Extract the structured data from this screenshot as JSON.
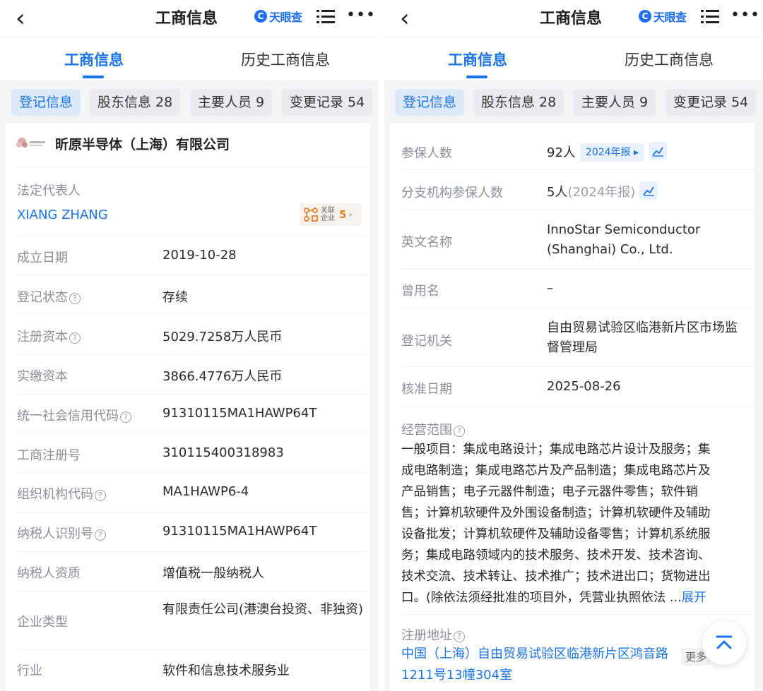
{
  "header": {
    "title": "工商信息",
    "logo_text": "天眼查",
    "logo_mark": "C",
    "back_icon": "chevron-left-icon",
    "menu_icon": "list-icon",
    "more_icon": "more-horizontal-icon",
    "more_glyph": "•••"
  },
  "tabs": [
    {
      "label": "工商信息",
      "active": true
    },
    {
      "label": "历史工商信息",
      "active": false
    }
  ],
  "chips": [
    {
      "label": "登记信息",
      "active": true
    },
    {
      "label": "股东信息 28",
      "active": false
    },
    {
      "label": "主要人员 9",
      "active": false
    },
    {
      "label": "变更记录 54",
      "active": false
    }
  ],
  "left": {
    "company_name": "昕原半导体（上海）有限公司",
    "legal_rep": {
      "label": "法定代表人",
      "value": "XIANG ZHANG",
      "related_label": "关联企业",
      "related_count": "5"
    },
    "rows": [
      {
        "label": "成立日期",
        "value": "2019-10-28",
        "help": false
      },
      {
        "label": "登记状态",
        "value": "存续",
        "help": true
      },
      {
        "label": "注册资本",
        "value": "5029.7258万人民币",
        "help": true
      },
      {
        "label": "实缴资本",
        "value": "3866.4776万人民币",
        "help": false
      },
      {
        "label": "统一社会信用代码",
        "value": "91310115MA1HAWP64T",
        "help": true
      },
      {
        "label": "工商注册号",
        "value": "310115400318983",
        "help": false
      },
      {
        "label": "组织机构代码",
        "value": "MA1HAWP6-4",
        "help": true
      },
      {
        "label": "纳税人识别号",
        "value": "91310115MA1HAWP64T",
        "help": true
      },
      {
        "label": "纳税人资质",
        "value": "增值税一般纳税人",
        "help": false
      },
      {
        "label": "企业类型",
        "value": "有限责任公司(港澳台投资、非独资)",
        "help": false
      },
      {
        "label": "行业",
        "value": "软件和信息技术服务业",
        "help": false
      }
    ]
  },
  "right": {
    "insured": {
      "label": "参保人数",
      "value": "92人",
      "badge": "2024年报 ▸"
    },
    "branch_insured": {
      "label": "分支机构参保人数",
      "value": "5人",
      "note": "(2024年报)"
    },
    "english_name": {
      "label": "英文名称",
      "value": "InnoStar Semiconductor (Shanghai) Co., Ltd."
    },
    "former_name": {
      "label": "曾用名",
      "value": "–"
    },
    "authority": {
      "label": "登记机关",
      "value": "自由贸易试验区临港新片区市场监督管理局"
    },
    "approval_date": {
      "label": "核准日期",
      "value": "2025-08-26"
    },
    "scope": {
      "label": "经营范围",
      "lines": [
        "一般项目：集成电路设计；集成电路芯片设计及服务；集",
        "成电路制造；集成电路芯片及产品制造；集成电路芯片及",
        "产品销售；电子元器件制造；电子元器件零售；软件销",
        "售；计算机软硬件及外围设备制造；计算机软硬件及辅助",
        "设备批发；计算机软硬件及辅助设备零售；计算机系统服",
        "务；集成电路领域内的技术服务、技术开发、技术咨询、",
        "技术交流、技术转让、技术推广；技术进出口；货物进出",
        "口。(除依法须经批准的项目外，凭营业执照依法 ..."
      ],
      "expand": "展开"
    },
    "address": {
      "label": "注册地址",
      "lines": [
        "中国（上海）自由贸易试验区临港新片区鸿音路",
        "1211号13幢304室"
      ],
      "more": "更多"
    }
  }
}
